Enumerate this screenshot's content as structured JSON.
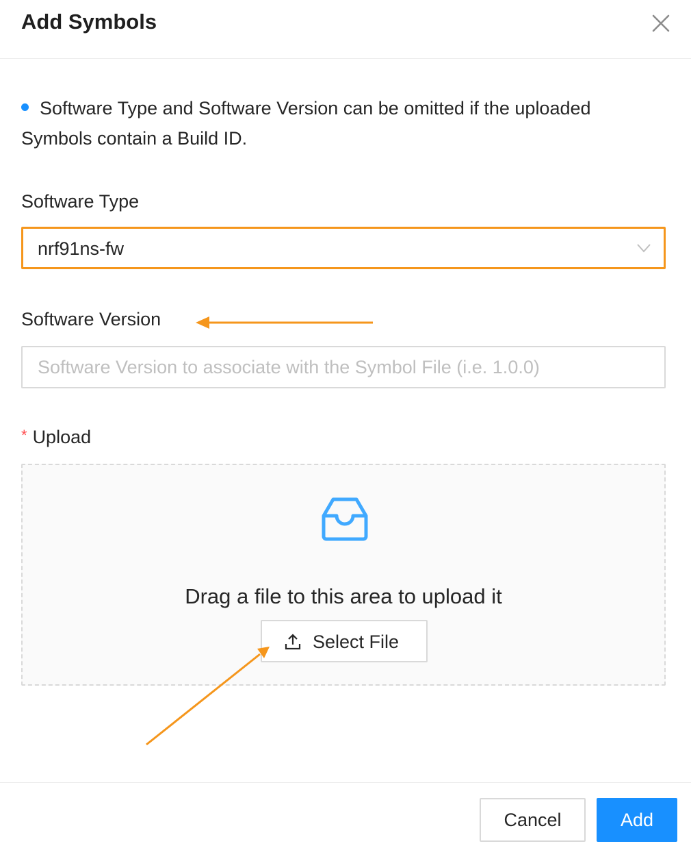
{
  "dialog": {
    "title": "Add Symbols"
  },
  "info": {
    "text": "Software Type and Software Version can be omitted if the uploaded Symbols contain a Build ID."
  },
  "software_type": {
    "label": "Software Type",
    "value": "nrf91ns-fw"
  },
  "software_version": {
    "label": "Software Version",
    "value": "",
    "placeholder": "Software Version to associate with the Symbol File (i.e. 1.0.0)"
  },
  "upload": {
    "required_mark": "*",
    "label": "Upload",
    "drop_text": "Drag a file to this area to upload it",
    "select_file_label": "Select File"
  },
  "footer": {
    "cancel_label": "Cancel",
    "add_label": "Add"
  },
  "icons": {
    "close": "close-icon",
    "chevron": "chevron-down-icon",
    "inbox": "inbox-icon",
    "upload": "upload-icon"
  },
  "colors": {
    "primary": "#1890ff",
    "highlight": "#f5961c",
    "required": "#ff4d4f"
  }
}
